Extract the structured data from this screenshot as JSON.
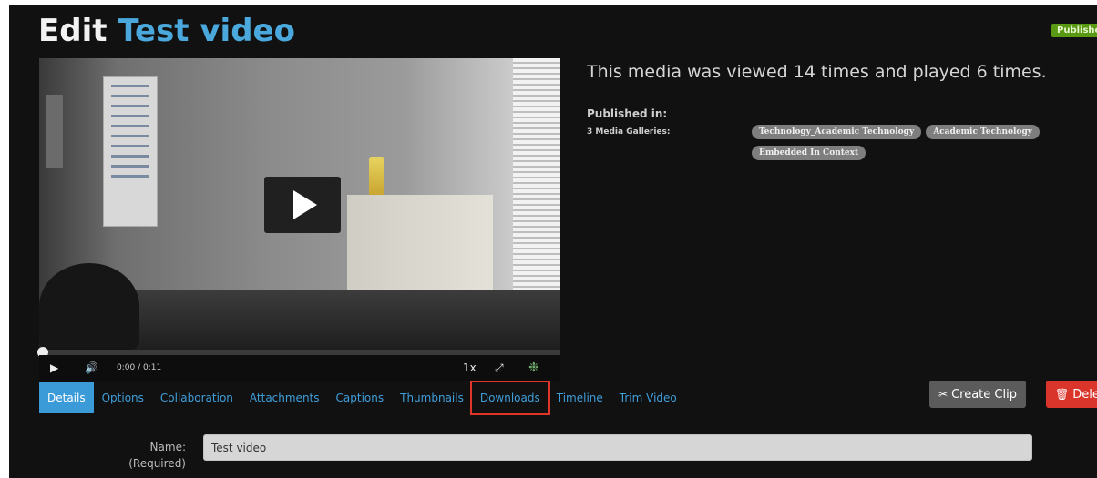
{
  "header": {
    "title_prefix": "Edit",
    "title_name": "Test video",
    "status_badge": "Publishe"
  },
  "player": {
    "play_icon": "▶",
    "volume_icon": "🔊",
    "time": "0:00 / 0:11",
    "speed": "1x",
    "fullscreen_icon": "⤢",
    "logo_icon": "❉",
    "progress": 0.0
  },
  "stats": {
    "views_text": "This media was viewed 14 times and played 6 times."
  },
  "published": {
    "label": "Published in:",
    "galleries_label": "3 Media Galleries:",
    "tags": [
      "Technology_Academic Technology",
      "Academic Technology",
      "Embedded In Context"
    ]
  },
  "tabs": [
    "Details",
    "Options",
    "Collaboration",
    "Attachments",
    "Captions",
    "Thumbnails",
    "Downloads",
    "Timeline",
    "Trim Video"
  ],
  "actions": {
    "create_clip_icon": "✂",
    "create_clip": "Create Clip",
    "delete_icon": "🗑",
    "delete": "Delete"
  },
  "form": {
    "name_label": "Name:",
    "required_label": "(Required)",
    "name_value": "Test video"
  },
  "colors": {
    "accent": "#3a9bd8",
    "highlight": "#e0362a",
    "badge": "#5a9a12",
    "delete": "#d9352b"
  }
}
